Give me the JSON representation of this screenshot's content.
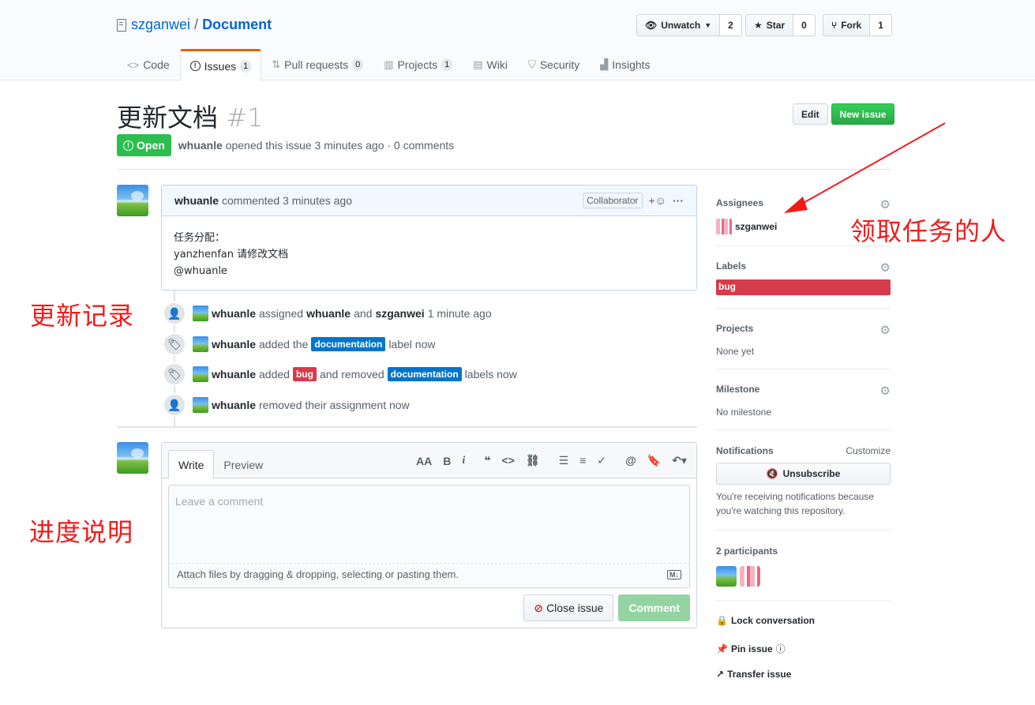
{
  "repo": {
    "owner": "szganwei",
    "separator": "/",
    "name": "Document"
  },
  "actions": [
    {
      "label": "Unwatch",
      "icon": "eye-icon",
      "count": "2"
    },
    {
      "label": "Star",
      "icon": "star-icon",
      "count": "0"
    },
    {
      "label": "Fork",
      "icon": "fork-icon",
      "count": "1"
    }
  ],
  "nav": [
    {
      "label": "Code",
      "icon": "code-icon",
      "counter": ""
    },
    {
      "label": "Issues",
      "icon": "issue-icon",
      "counter": "1"
    },
    {
      "label": "Pull requests",
      "icon": "pull-request-icon",
      "counter": "0"
    },
    {
      "label": "Projects",
      "icon": "project-icon",
      "counter": "1"
    },
    {
      "label": "Wiki",
      "icon": "book-icon",
      "counter": ""
    },
    {
      "label": "Security",
      "icon": "shield-icon",
      "counter": ""
    },
    {
      "label": "Insights",
      "icon": "graph-icon",
      "counter": ""
    }
  ],
  "issue": {
    "title": "更新文档",
    "number": "#1",
    "edit_label": "Edit",
    "new_issue_label": "New issue",
    "state": "Open",
    "author": "whuanle",
    "meta_text": "opened this issue 3 minutes ago · 0 comments"
  },
  "comment": {
    "author": "whuanle",
    "time": "commented 3 minutes ago",
    "role": "Collaborator",
    "body": [
      "任务分配：",
      "yanzhenfan 请修改文档",
      "@whuanle"
    ]
  },
  "timeline": {
    "e1": {
      "actor": "whuanle",
      "t1": "assigned",
      "u1": "whuanle",
      "t2": "and",
      "u2": "szganwei",
      "time": "1 minute ago"
    },
    "e2": {
      "actor": "whuanle",
      "t1": "added the",
      "label": "documentation",
      "t2": "label now"
    },
    "e3": {
      "actor": "whuanle",
      "t1": "added",
      "label1": "bug",
      "t2": "and removed",
      "label2": "documentation",
      "t3": "labels now"
    },
    "e4": {
      "actor": "whuanle",
      "t1": "removed their assignment now"
    }
  },
  "new_comment": {
    "tab_write": "Write",
    "tab_preview": "Preview",
    "placeholder": "Leave a comment",
    "attach_text": "Attach files by dragging & dropping, selecting or pasting them.",
    "close_label": "Close issue",
    "comment_label": "Comment"
  },
  "sidebar": {
    "assignees_title": "Assignees",
    "assignee": "szganwei",
    "labels_title": "Labels",
    "label": "bug",
    "projects_title": "Projects",
    "projects_value": "None yet",
    "milestone_title": "Milestone",
    "milestone_value": "No milestone",
    "notifications_title": "Notifications",
    "customize": "Customize",
    "unsubscribe": "Unsubscribe",
    "notif_note": "You're receiving notifications because you're watching this repository.",
    "participants_title": "2 participants",
    "lock": "Lock conversation",
    "pin": "Pin issue",
    "transfer": "Transfer issue"
  },
  "annotations": {
    "assignee_note": "领取任务的人",
    "timeline_note": "更新记录",
    "progress_note": "进度说明"
  },
  "colors": {
    "open": "#2cbe4e",
    "bug": "#d73a4a",
    "documentation": "#0075ca",
    "annotation": "#f21b1b",
    "link": "#0366d6"
  }
}
